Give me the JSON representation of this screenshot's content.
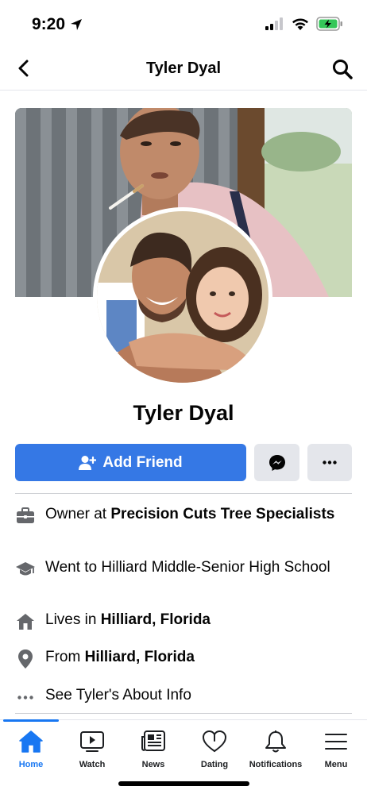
{
  "status_bar": {
    "time": "9:20"
  },
  "header": {
    "title": "Tyler Dyal"
  },
  "profile": {
    "name": "Tyler Dyal"
  },
  "actions": {
    "add_friend_label": "Add Friend"
  },
  "details": {
    "work": {
      "prefix": "Owner at ",
      "highlight": "Precision Cuts Tree Specialists"
    },
    "education": {
      "prefix": "Went to Hilliard Middle-Senior High School"
    },
    "lives": {
      "prefix": "Lives in ",
      "highlight": "Hilliard, Florida"
    },
    "from": {
      "prefix": "From ",
      "highlight": "Hilliard, Florida"
    },
    "about": {
      "label": "See Tyler's About Info"
    }
  },
  "tabs": [
    {
      "label": "Home",
      "icon": "home-icon",
      "active": true
    },
    {
      "label": "Watch",
      "icon": "watch-icon"
    },
    {
      "label": "News",
      "icon": "news-icon"
    },
    {
      "label": "Dating",
      "icon": "dating-icon"
    },
    {
      "label": "Notifications",
      "icon": "bell-icon"
    },
    {
      "label": "Menu",
      "icon": "menu-icon"
    }
  ],
  "colors": {
    "accent": "#1877f2",
    "add_friend_bg": "#3578e5",
    "secondary_button_bg": "#e4e6eb",
    "battery_green": "#34c759"
  }
}
